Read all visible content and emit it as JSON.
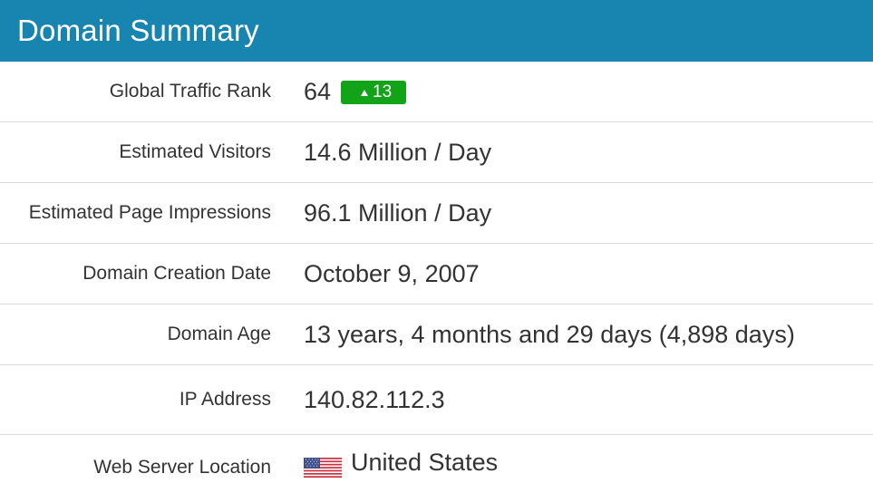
{
  "header": {
    "title": "Domain Summary"
  },
  "rows": [
    {
      "label": "Global Traffic Rank",
      "value": "64",
      "badge": "13"
    },
    {
      "label": "Estimated Visitors",
      "value": "14.6 Million / Day"
    },
    {
      "label": "Estimated Page Impressions",
      "value": "96.1 Million / Day"
    },
    {
      "label": "Domain Creation Date",
      "value": "October 9, 2007"
    },
    {
      "label": "Domain Age",
      "value": "13 years, 4 months and 29 days (4,898 days)"
    },
    {
      "label": "IP Address",
      "value": "140.82.112.3"
    },
    {
      "label": "Web Server Location",
      "value": "United States",
      "icon": "us-flag-icon"
    }
  ],
  "colors": {
    "header_bg": "#1884b0",
    "badge_bg": "#13a319",
    "divider": "#dddddd",
    "text": "#333333"
  }
}
